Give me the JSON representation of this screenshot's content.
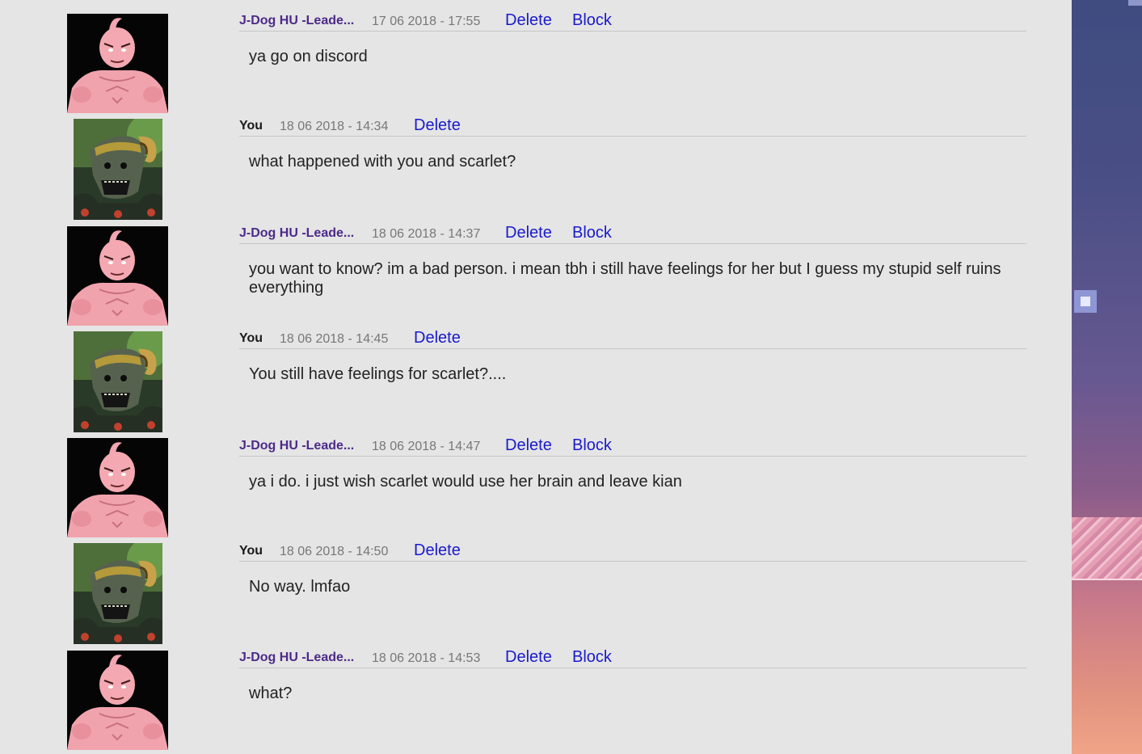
{
  "conversation": {
    "action_delete": "Delete",
    "action_block": "Block",
    "messages": [
      {
        "author": "J-Dog HU -Leade...",
        "timestamp": "17 06 2018 - 17:55",
        "text": "ya go on discord"
      },
      {
        "author": "You",
        "timestamp": "18 06 2018 - 14:34",
        "text": "what happened with you and scarlet?"
      },
      {
        "author": "J-Dog HU -Leade...",
        "timestamp": "18 06 2018 - 14:37",
        "text": "you want to know? im a bad person. i mean tbh i still have feelings for her but I guess my stupid self ruins everything"
      },
      {
        "author": "You",
        "timestamp": "18 06 2018 - 14:45",
        "text": "You still have feelings for scarlet?...."
      },
      {
        "author": "J-Dog HU -Leade...",
        "timestamp": "18 06 2018 - 14:47",
        "text": "ya i do. i just wish scarlet would use her brain and leave kian"
      },
      {
        "author": "You",
        "timestamp": "18 06 2018 - 14:50",
        "text": "No way. lmfao"
      },
      {
        "author": "J-Dog HU -Leade...",
        "timestamp": "18 06 2018 - 14:53",
        "text": "what?"
      }
    ]
  },
  "colors": {
    "page_background": "#e5e5e5",
    "other_author": "#4d2a8a",
    "self_author": "#1a1a1a",
    "timestamp": "#777777",
    "action_link": "#1a1acc",
    "divider": "#c6c6c6"
  }
}
